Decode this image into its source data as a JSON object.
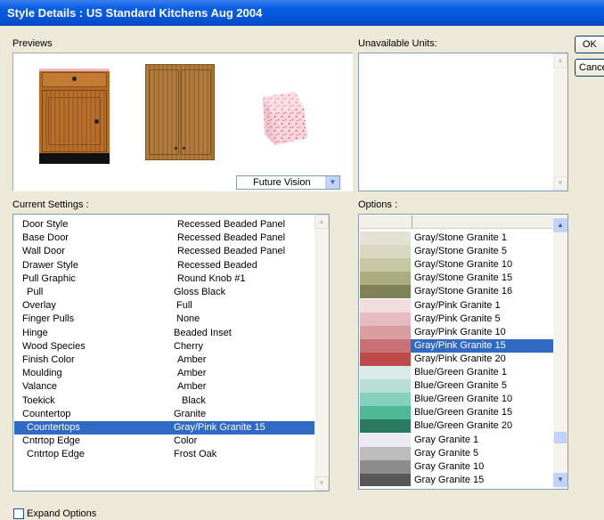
{
  "window": {
    "title": "Style Details : US Standard Kitchens Aug 2004"
  },
  "buttons": {
    "ok": "OK",
    "cancel": "Cancel"
  },
  "previews": {
    "label": "Previews",
    "dropdown_value": "Future Vision"
  },
  "unavailable": {
    "label": "Unavailable Units:"
  },
  "settings": {
    "label": "Current Settings :",
    "rows": [
      {
        "k": "Door Style",
        "v": "Recessed Beaded Panel"
      },
      {
        "k": "Base Door",
        "v": "Recessed Beaded Panel"
      },
      {
        "k": "Wall Door",
        "v": "Recessed Beaded Panel"
      },
      {
        "k": "Drawer Style",
        "v": "Recessed Beaded"
      },
      {
        "k": "Pull Graphic",
        "v": "Round Knob #1"
      },
      {
        "k": "Pull",
        "v": "Gloss Black"
      },
      {
        "k": "Overlay",
        "v": "Full"
      },
      {
        "k": "Finger Pulls",
        "v": "None"
      },
      {
        "k": "Hinge",
        "v": "Beaded Inset"
      },
      {
        "k": "Wood Species",
        "v": "Cherry"
      },
      {
        "k": "Finish Color",
        "v": "Amber"
      },
      {
        "k": "Moulding",
        "v": "Amber"
      },
      {
        "k": "Valance",
        "v": "Amber"
      },
      {
        "k": "Toekick",
        "v": "Black"
      },
      {
        "k": "Countertop",
        "v": "Granite"
      },
      {
        "k": "Countertops",
        "v": "Gray/Pink Granite 15"
      },
      {
        "k": "Cntrtop Edge",
        "v": "Color"
      },
      {
        "k": "Cntrtop Edge",
        "v": "Frost Oak"
      }
    ]
  },
  "options": {
    "label": "Options :",
    "items": [
      {
        "name": "Gray/Stone Granite 1",
        "color": "#e4e2d4"
      },
      {
        "name": "Gray/Stone Granite 5",
        "color": "#d9d8c2"
      },
      {
        "name": "Gray/Stone Granite 10",
        "color": "#c6c8a4"
      },
      {
        "name": "Gray/Stone Granite 15",
        "color": "#aaad80"
      },
      {
        "name": "Gray/Stone Granite 16",
        "color": "#7f8257"
      },
      {
        "name": "Gray/Pink Granite 1",
        "color": "#f1dde0"
      },
      {
        "name": "Gray/Pink Granite 5",
        "color": "#e6bcc1"
      },
      {
        "name": "Gray/Pink Granite 10",
        "color": "#d99ea2"
      },
      {
        "name": "Gray/Pink Granite 15",
        "color": "#c87278"
      },
      {
        "name": "Gray/Pink Granite 20",
        "color": "#bf4a4c"
      },
      {
        "name": "Blue/Green Granite 1",
        "color": "#d9ebe6"
      },
      {
        "name": "Blue/Green Granite 5",
        "color": "#b7dfd5"
      },
      {
        "name": "Blue/Green Granite 10",
        "color": "#84d0bd"
      },
      {
        "name": "Blue/Green Granite 15",
        "color": "#4fb895"
      },
      {
        "name": "Blue/Green Granite 20",
        "color": "#2b7a5f"
      },
      {
        "name": "Gray Granite 1",
        "color": "#ebe9f1"
      },
      {
        "name": "Gray Granite 5",
        "color": "#bdbdbd"
      },
      {
        "name": "Gray Granite 10",
        "color": "#8d8d8d"
      },
      {
        "name": "Gray Granite 15",
        "color": "#575757"
      }
    ],
    "selected": "Gray/Pink Granite 15"
  },
  "expand": {
    "label": "Expand Options",
    "checked": false
  },
  "icons": {
    "scroll_up": "arrow-up-icon",
    "scroll_down": "arrow-down-icon",
    "dropdown": "chevron-down-icon"
  }
}
